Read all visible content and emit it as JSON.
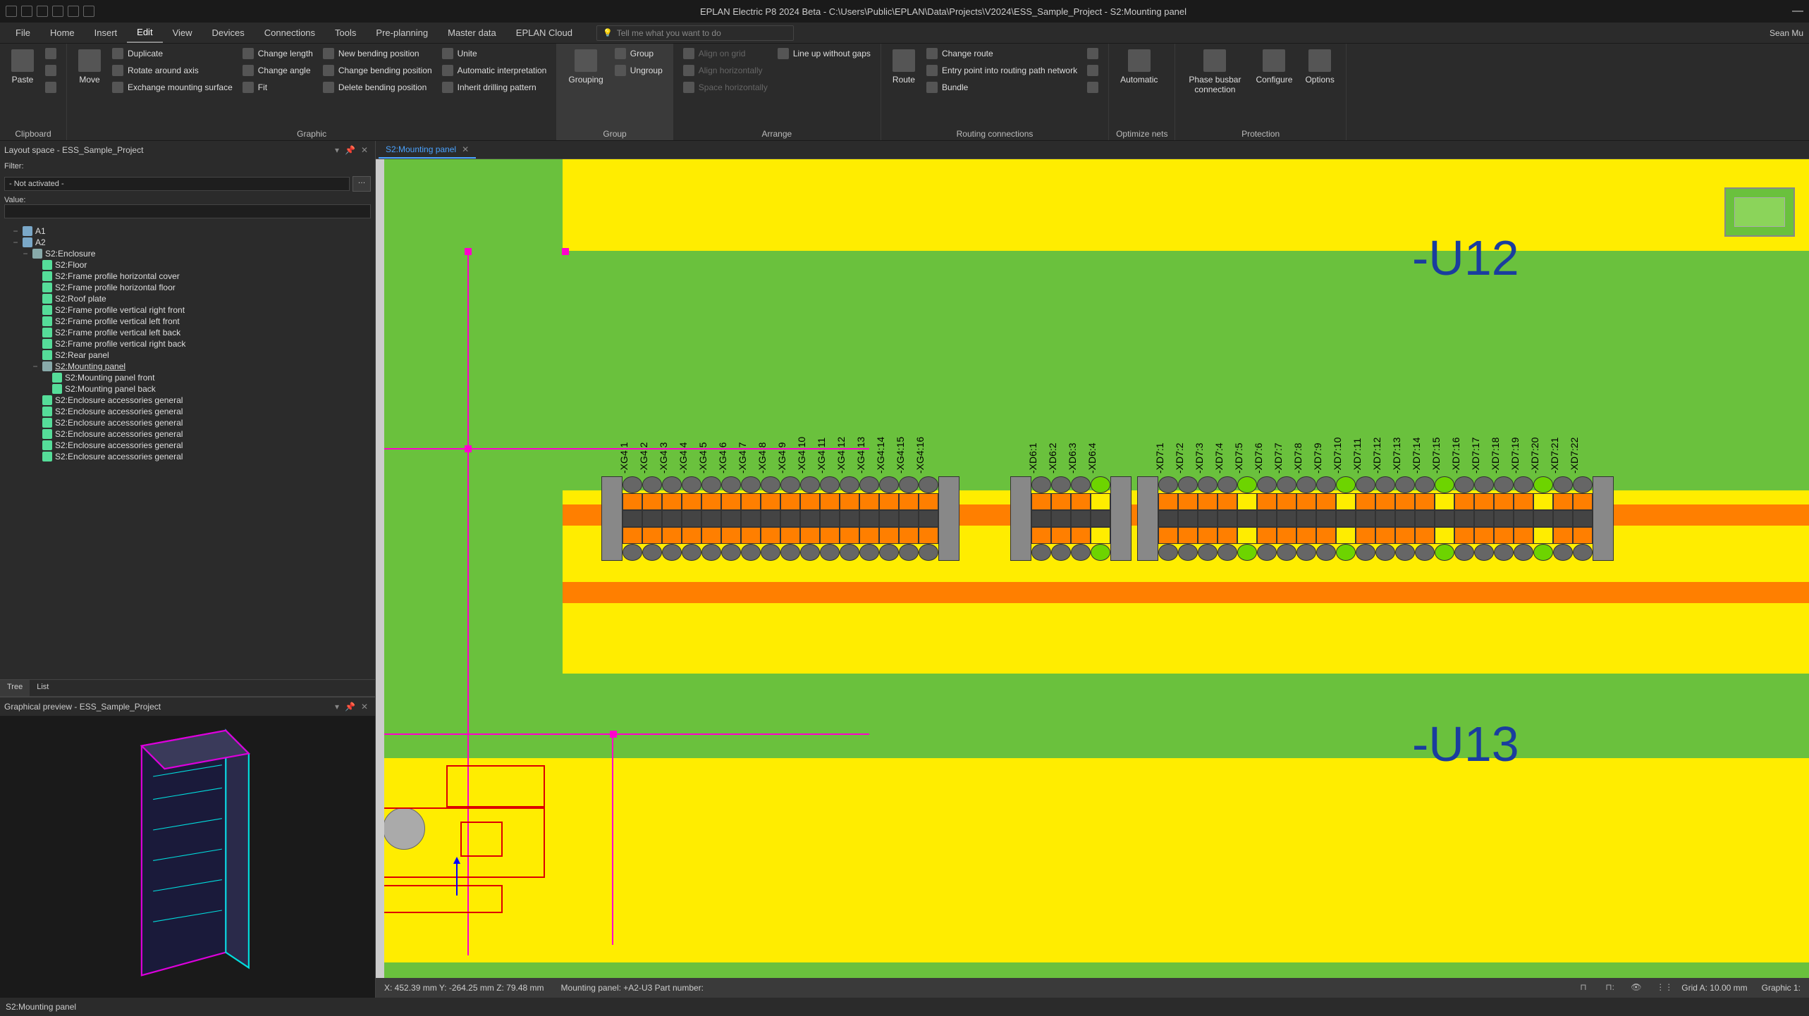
{
  "titlebar": {
    "title": "EPLAN Electric P8 2024 Beta - C:\\Users\\Public\\EPLAN\\Data\\Projects\\V2024\\ESS_Sample_Project - S2:Mounting panel"
  },
  "ribbon_tabs": {
    "items": [
      "File",
      "Home",
      "Insert",
      "Edit",
      "View",
      "Devices",
      "Connections",
      "Tools",
      "Pre-planning",
      "Master data",
      "EPLAN Cloud"
    ],
    "active": "Edit",
    "search_placeholder": "Tell me what you want to do",
    "user": "Sean Mu"
  },
  "ribbon": {
    "clipboard": {
      "label": "Clipboard",
      "paste": "Paste"
    },
    "move_group": {
      "move": "Move",
      "duplicate": "Duplicate",
      "rotate": "Rotate around axis",
      "exchange": "Exchange mounting surface"
    },
    "graphic": {
      "label": "Graphic",
      "change_length": "Change length",
      "change_angle": "Change angle",
      "fit": "Fit",
      "new_bending": "New bending position",
      "change_bending": "Change bending position",
      "delete_bending": "Delete bending position",
      "unite": "Unite",
      "auto_interp": "Automatic interpretation",
      "inherit_drill": "Inherit drilling pattern"
    },
    "group": {
      "label": "Group",
      "grouping": "Grouping",
      "group_btn": "Group",
      "ungroup": "Ungroup"
    },
    "arrange": {
      "label": "Arrange",
      "align_grid": "Align on grid",
      "align_h": "Align horizontally",
      "space_h": "Space horizontally",
      "line_up": "Line up without gaps"
    },
    "routing": {
      "label": "Routing connections",
      "route": "Route",
      "change_route": "Change route",
      "entry_point": "Entry point into routing path network",
      "bundle": "Bundle"
    },
    "optimize": {
      "label": "Optimize nets",
      "automatic": "Automatic"
    },
    "protection": {
      "label": "Protection",
      "phase_busbar": "Phase busbar connection",
      "configure": "Configure",
      "options": "Options"
    }
  },
  "layout_panel": {
    "title": "Layout space - ESS_Sample_Project",
    "filter_label": "Filter:",
    "filter_value": "- Not activated -",
    "value_label": "Value:",
    "value_value": "",
    "tree": [
      {
        "l": 1,
        "exp": "−",
        "icon": "cube",
        "label": "A1"
      },
      {
        "l": 1,
        "exp": "−",
        "icon": "cube",
        "label": "A2"
      },
      {
        "l": 2,
        "exp": "−",
        "icon": "box",
        "label": "S2:Enclosure"
      },
      {
        "l": 3,
        "exp": "",
        "icon": "panel",
        "label": "S2:Floor"
      },
      {
        "l": 3,
        "exp": "",
        "icon": "panel",
        "label": "S2:Frame profile horizontal cover"
      },
      {
        "l": 3,
        "exp": "",
        "icon": "panel",
        "label": "S2:Frame profile horizontal floor"
      },
      {
        "l": 3,
        "exp": "",
        "icon": "panel",
        "label": "S2:Roof plate"
      },
      {
        "l": 3,
        "exp": "",
        "icon": "panel",
        "label": "S2:Frame profile vertical right front"
      },
      {
        "l": 3,
        "exp": "",
        "icon": "panel",
        "label": "S2:Frame profile vertical left front"
      },
      {
        "l": 3,
        "exp": "",
        "icon": "panel",
        "label": "S2:Frame profile vertical left back"
      },
      {
        "l": 3,
        "exp": "",
        "icon": "panel",
        "label": "S2:Frame profile vertical right back"
      },
      {
        "l": 3,
        "exp": "",
        "icon": "panel",
        "label": "S2:Rear panel"
      },
      {
        "l": 3,
        "exp": "−",
        "icon": "box",
        "label": "S2:Mounting panel",
        "sel": true
      },
      {
        "l": 4,
        "exp": "",
        "icon": "item",
        "label": "S2:Mounting panel front"
      },
      {
        "l": 4,
        "exp": "",
        "icon": "item",
        "label": "S2:Mounting panel back"
      },
      {
        "l": 3,
        "exp": "",
        "icon": "panel",
        "label": "S2:Enclosure accessories general"
      },
      {
        "l": 3,
        "exp": "",
        "icon": "panel",
        "label": "S2:Enclosure accessories general"
      },
      {
        "l": 3,
        "exp": "",
        "icon": "panel",
        "label": "S2:Enclosure accessories general"
      },
      {
        "l": 3,
        "exp": "",
        "icon": "panel",
        "label": "S2:Enclosure accessories general"
      },
      {
        "l": 3,
        "exp": "",
        "icon": "panel",
        "label": "S2:Enclosure accessories general"
      },
      {
        "l": 3,
        "exp": "",
        "icon": "panel",
        "label": "S2:Enclosure accessories general"
      }
    ],
    "bottom_tabs": [
      "Tree",
      "List"
    ],
    "bottom_active": "Tree"
  },
  "preview_panel": {
    "title": "Graphical preview - ESS_Sample_Project"
  },
  "doc_tab": {
    "label": "S2:Mounting panel"
  },
  "canvas": {
    "u12": "-U12",
    "u13": "-U13",
    "xg4": [
      "-XG4:1",
      "-XG4:2",
      "-XG4:3",
      "-XG4:4",
      "-XG4:5",
      "-XG4:6",
      "-XG4:7",
      "-XG4:8",
      "-XG4:9",
      "-XG4:10",
      "-XG4:11",
      "-XG4:12",
      "-XG4:13",
      "-XG4:14",
      "-XG4:15",
      "-XG4:16"
    ],
    "xd6": [
      "-XD6:1",
      "-XD6:2",
      "-XD6:3",
      "-XD6:4"
    ],
    "xd7": [
      "-XD7:1",
      "-XD7:2",
      "-XD7:3",
      "-XD7:4",
      "-XD7:5",
      "-XD7:6",
      "-XD7:7",
      "-XD7:8",
      "-XD7:9",
      "-XD7:10",
      "-XD7:11",
      "-XD7:12",
      "-XD7:13",
      "-XD7:14",
      "-XD7:15",
      "-XD7:16",
      "-XD7:17",
      "-XD7:18",
      "-XD7:19",
      "-XD7:20",
      "-XD7:21",
      "-XD7:22"
    ]
  },
  "canvas_status": {
    "coords": "X: 452.39 mm Y: -264.25 mm Z: 79.48 mm",
    "panel": "Mounting panel: +A2-U3 Part number:",
    "grid": "Grid A: 10.00 mm",
    "graphic": "Graphic 1:"
  },
  "statusbar": {
    "text": "S2:Mounting panel"
  }
}
